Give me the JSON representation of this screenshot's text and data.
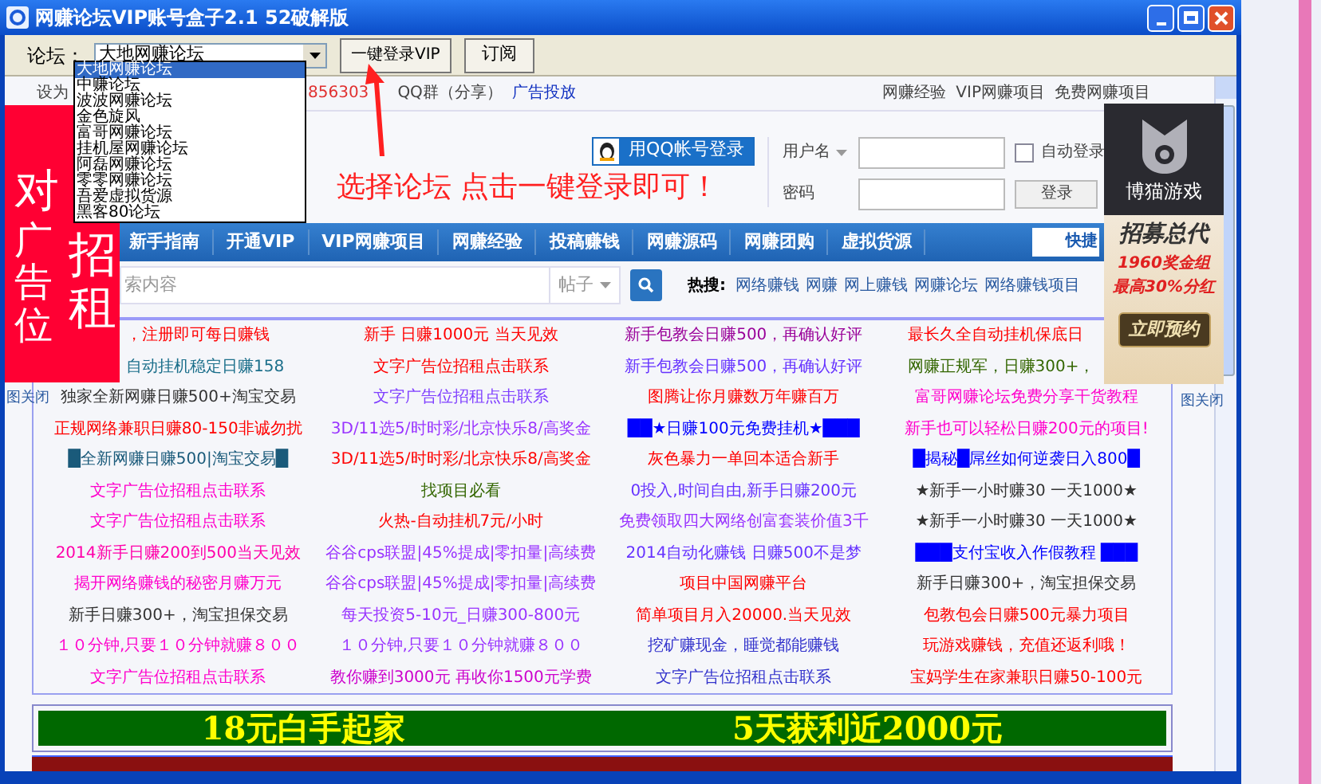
{
  "window": {
    "title": "网赚论坛VIP账号盒子2.1 52破解版"
  },
  "toolbar": {
    "forum_label": "论坛：",
    "forum_value": "大地网赚论坛",
    "login_button": "一键登录VIP",
    "subscribe_button": "订阅"
  },
  "forum_dropdown": {
    "options": [
      {
        "label": "大地网赚论坛",
        "selected": true
      },
      {
        "label": "中赚论坛",
        "selected": false
      },
      {
        "label": "波波网赚论坛",
        "selected": false
      },
      {
        "label": "金色旋风",
        "selected": false
      },
      {
        "label": "富哥网赚论坛",
        "selected": false
      },
      {
        "label": "挂机屋网赚论坛",
        "selected": false
      },
      {
        "label": "阿磊网赚论坛",
        "selected": false
      },
      {
        "label": "零零网赚论坛",
        "selected": false
      },
      {
        "label": "吾爱虚拟货源",
        "selected": false
      },
      {
        "label": "黑客80论坛",
        "selected": false
      }
    ]
  },
  "instruction": "选择论坛 点击一键登录即可！",
  "top_bar": {
    "left_text": "设为",
    "phone": "856303",
    "qq_group": "QQ群（分享）",
    "ad_link": "广告投放",
    "links": [
      "网赚经验",
      "VIP网赚项目",
      "免费网赚项目"
    ]
  },
  "login": {
    "qq_button": "用QQ帐号登录",
    "username_label": "用户名",
    "password_label": "密码",
    "auto_login": {
      "label": "自动登录",
      "checked": false
    },
    "login_button": "登录"
  },
  "nav": {
    "items": [
      "新手指南",
      "开通VIP",
      "VIP网赚项目",
      "网赚经验",
      "投稿赚钱",
      "网赚源码",
      "网赚团购",
      "虚拟货源"
    ],
    "quick": "快捷"
  },
  "search": {
    "placeholder": "索内容",
    "scope": "帖子",
    "hot_label": "热搜:",
    "hot_links": [
      "网络赚钱",
      "网赚",
      "网上赚钱",
      "网赚论坛",
      "网络赚钱项目"
    ]
  },
  "link_grid": {
    "rows": [
      [
        {
          "text": "，注册即可每日赚钱",
          "color": "#ff0000"
        },
        {
          "text": "新手 日赚1000元 当天见效",
          "color": "#ff0000"
        },
        {
          "text": "新手包教会日赚500，再确认好评",
          "color": "#990099"
        },
        {
          "text": "最长久全自动挂机保底日",
          "color": "#ff0000"
        }
      ],
      [
        {
          "text": "自动挂机稳定日赚158",
          "color": "#1a6e8a"
        },
        {
          "text": "文字广告位招租点击联系",
          "color": "#ff0000"
        },
        {
          "text": "新手包教会日赚500，再确认好评",
          "color": "#6633ff"
        },
        {
          "text": "网赚正规军，日赚300+，",
          "color": "#336600"
        }
      ],
      [
        {
          "text": "独家全新网赚日赚500+淘宝交易",
          "color": "#333333"
        },
        {
          "text": "文字广告位招租点击联系",
          "color": "#7f3fff"
        },
        {
          "text": "图腾让你月赚数万年赚百万",
          "color": "#ff0000"
        },
        {
          "text": "富哥网赚论坛免费分享干货教程",
          "color": "#ff00cc"
        }
      ],
      [
        {
          "text": "正规网络兼职日赚80-150非诚勿扰",
          "color": "#ff0000"
        },
        {
          "text": "3D/11选5/时时彩/北京快乐8/高奖金",
          "color": "#9933ff"
        },
        {
          "text": "██★日赚100元免费挂机★███",
          "color": "#0000ff"
        },
        {
          "text": "新手也可以轻松日赚200元的项目!",
          "color": "#ff00cc"
        }
      ],
      [
        {
          "text": "█全新网赚日赚500|淘宝交易█",
          "color": "#1a5a7a"
        },
        {
          "text": "3D/11选5/时时彩/北京快乐8/高奖金",
          "color": "#ff0000"
        },
        {
          "text": "灰色暴力一单回本适合新手",
          "color": "#ff0000"
        },
        {
          "text": "█揭秘█屌丝如何逆袭日入800█",
          "color": "#0000ff"
        }
      ],
      [
        {
          "text": "文字广告位招租点击联系",
          "color": "#ff00cc"
        },
        {
          "text": "找项目必看",
          "color": "#336600"
        },
        {
          "text": "0投入,时间自由,新手日赚200元",
          "color": "#6633ff"
        },
        {
          "text": "★新手一小时赚30 一天1000★",
          "color": "#333333"
        }
      ],
      [
        {
          "text": "文字广告位招租点击联系",
          "color": "#ff00cc"
        },
        {
          "text": "火热-自动挂机7元/小时",
          "color": "#ff0000"
        },
        {
          "text": "免费领取四大网络创富套装价值3千",
          "color": "#9933ff"
        },
        {
          "text": "★新手一小时赚30 一天1000★",
          "color": "#333333"
        }
      ],
      [
        {
          "text": "2014新手日赚200到500当天见效",
          "color": "#ff00aa"
        },
        {
          "text": "谷谷cps联盟|45%提成|零扣量|高续费",
          "color": "#9933ff"
        },
        {
          "text": "2014自动化赚钱 日赚500不是梦",
          "color": "#6633ff"
        },
        {
          "text": "███支付宝收入作假教程 ███",
          "color": "#0000ff"
        }
      ],
      [
        {
          "text": "揭开网络赚钱的秘密月赚万元",
          "color": "#ff00cc"
        },
        {
          "text": "谷谷cps联盟|45%提成|零扣量|高续费",
          "color": "#9933ff"
        },
        {
          "text": "项目中国网赚平台",
          "color": "#ff0000"
        },
        {
          "text": "新手日赚300+，淘宝担保交易",
          "color": "#333333"
        }
      ],
      [
        {
          "text": "新手日赚300+，淘宝担保交易",
          "color": "#333333"
        },
        {
          "text": "每天投资5-10元_日赚300-800元",
          "color": "#9933ff"
        },
        {
          "text": "简单项目月入20000.当天见效",
          "color": "#ff0000"
        },
        {
          "text": "包教包会日赚500元暴力项目",
          "color": "#ff0000"
        }
      ],
      [
        {
          "text": "１０分钟,只要１０分钟就赚８００",
          "color": "#ff00cc"
        },
        {
          "text": "１０分钟,只要１０分钟就赚８００",
          "color": "#9933ff"
        },
        {
          "text": "挖矿赚现金，睡觉都能赚钱",
          "color": "#3333cc"
        },
        {
          "text": "玩游戏赚钱，充值还返利哦！",
          "color": "#ff0000"
        }
      ],
      [
        {
          "text": "文字广告位招租点击联系",
          "color": "#ff00cc"
        },
        {
          "text": "教你赚到3000元 再收你1500元学费",
          "color": "#cc00cc"
        },
        {
          "text": "文字广告位招租点击联系",
          "color": "#3333cc"
        },
        {
          "text": "宝妈学生在家兼职日赚50-100元",
          "color": "#ff0000"
        }
      ]
    ]
  },
  "left_ad": {
    "head": "对",
    "col1": "广告位",
    "col2": "招租",
    "close": "图关闭"
  },
  "right_ad": {
    "brand": "博猫游戏",
    "headline": "招募总代",
    "line1": "1960奖金组",
    "line2": "最高30%分红",
    "button": "立即预约",
    "close": "图关闭"
  },
  "banner": {
    "left": "18元白手起家",
    "right": "5天获利近2000元"
  }
}
